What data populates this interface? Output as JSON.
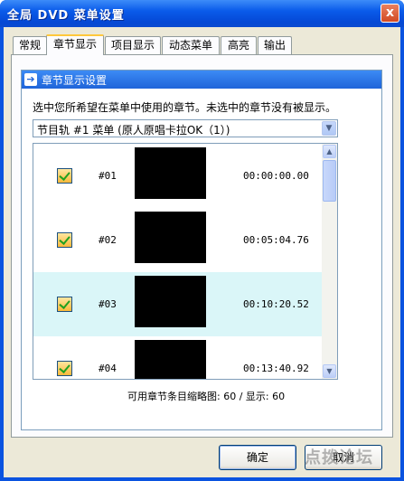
{
  "window": {
    "title": "全局 DVD 菜单设置",
    "close_glyph": "x"
  },
  "tabs": [
    {
      "label": "常规",
      "active": false
    },
    {
      "label": "章节显示",
      "active": true
    },
    {
      "label": "项目显示",
      "active": false
    },
    {
      "label": "动态菜单",
      "active": false
    },
    {
      "label": "高亮",
      "active": false
    },
    {
      "label": "输出",
      "active": false
    }
  ],
  "group": {
    "title": "章节显示设置",
    "icon": "arrow-right-icon"
  },
  "instruction": "选中您所希望在菜单中使用的章节。未选中的章节没有被显示。",
  "title_select": {
    "value": "节目轨 #1 菜单 (原人原唱卡拉OK（1）)"
  },
  "chapters": [
    {
      "number": "#01",
      "time": "00:00:00.00",
      "checked": true,
      "selected": false
    },
    {
      "number": "#02",
      "time": "00:05:04.76",
      "checked": true,
      "selected": false
    },
    {
      "number": "#03",
      "time": "00:10:20.52",
      "checked": true,
      "selected": true
    },
    {
      "number": "#04",
      "time": "00:13:40.92",
      "checked": true,
      "selected": false
    }
  ],
  "count_text": "可用章节条目缩略图: 60 / 显示: 60",
  "buttons": {
    "ok": "确定",
    "cancel": "取消"
  },
  "watermark": "点拨论坛",
  "colors": {
    "titlebar": "#0a5bea",
    "selected_row": "#daf6f8",
    "tab_highlight": "#ffc83c"
  }
}
